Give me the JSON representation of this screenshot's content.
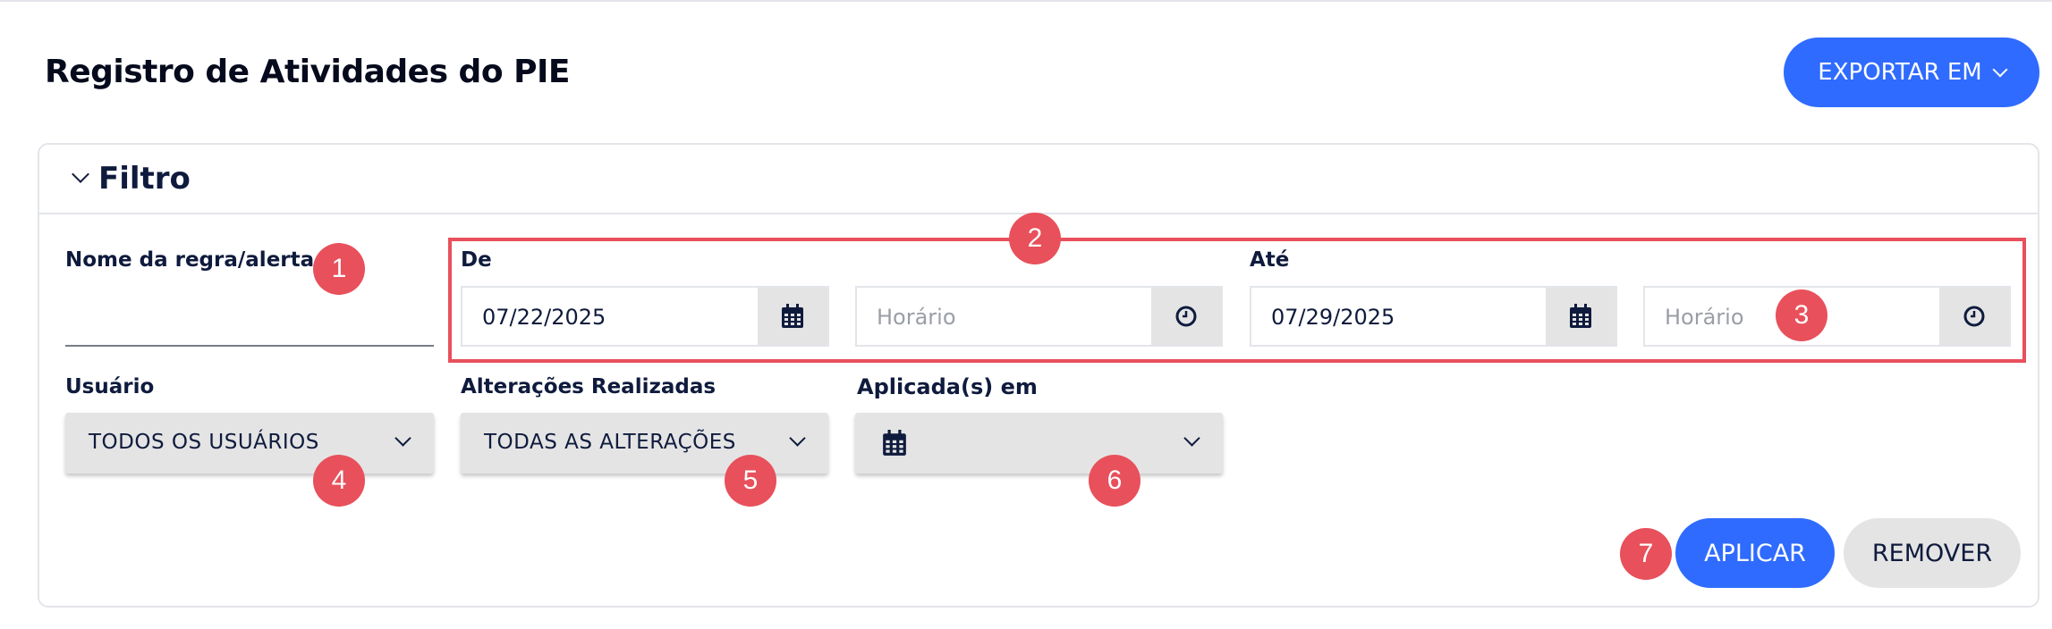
{
  "header": {
    "title": "Registro de Atividades do PIE",
    "export_label": "EXPORTAR EM"
  },
  "filter": {
    "title": "Filtro",
    "rule_name": {
      "label": "Nome da regra/alerta",
      "value": ""
    },
    "from": {
      "label": "De",
      "date": "07/22/2025",
      "time_placeholder": "Horário"
    },
    "to": {
      "label": "Até",
      "date": "07/29/2025",
      "time_placeholder": "Horário"
    },
    "user": {
      "label": "Usuário",
      "selected": "TODOS OS USUÁRIOS"
    },
    "changes": {
      "label": "Alterações Realizadas",
      "selected": "TODAS AS ALTERAÇÕES"
    },
    "applied_in": {
      "label": "Aplicada(s) em",
      "selected": ""
    },
    "apply_label": "APLICAR",
    "remove_label": "REMOVER"
  },
  "annotations": [
    "1",
    "2",
    "3",
    "4",
    "5",
    "6",
    "7"
  ],
  "colors": {
    "primary": "#2f6bff",
    "annotation": "#e8505b",
    "field_bg": "#e4e4e4",
    "text": "#0f1b3d"
  },
  "icons": {
    "calendar": "calendar-icon",
    "clock": "clock-icon",
    "chevron": "chevron-down-icon"
  }
}
